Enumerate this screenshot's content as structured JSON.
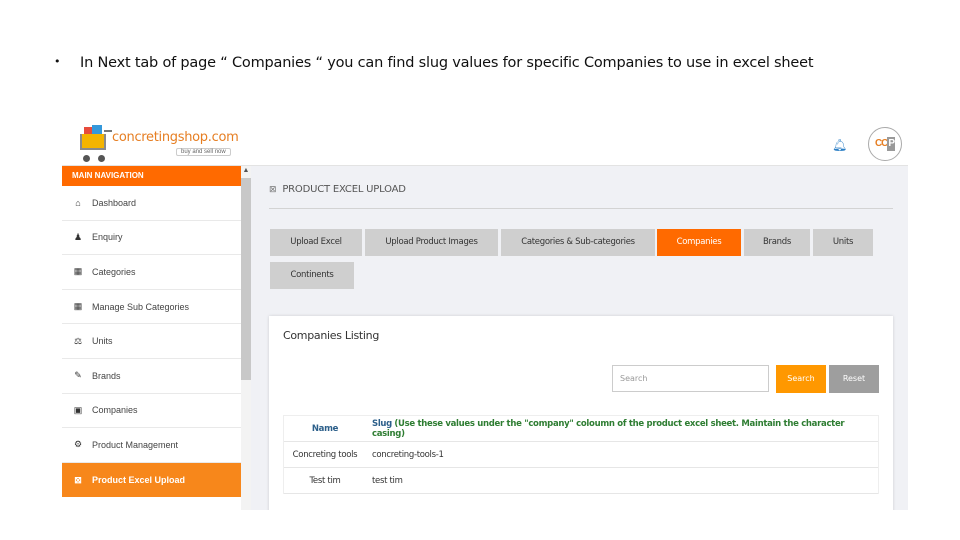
{
  "caption": {
    "bullet": "•",
    "text": "In Next tab of page “ Companies “ you can find slug values for specific Companies to use in excel sheet"
  },
  "header": {
    "brand": "concretingshop.com",
    "tagline": "buy and sell now",
    "bell_icon": "bell-icon",
    "avatar_text": "CC",
    "avatar_p": "P"
  },
  "sidebar": {
    "heading": "MAIN NAVIGATION",
    "items": [
      {
        "label": "Dashboard",
        "icon": "home-icon",
        "glyph": "⌂",
        "active": false
      },
      {
        "label": "Enquiry",
        "icon": "user-icon",
        "glyph": "♟",
        "active": false
      },
      {
        "label": "Categories",
        "icon": "grid-icon",
        "glyph": "▦",
        "active": false
      },
      {
        "label": "Manage Sub Categories",
        "icon": "grid-icon",
        "glyph": "▦",
        "active": false
      },
      {
        "label": "Units",
        "icon": "balance-scale-icon",
        "glyph": "⚖",
        "active": false
      },
      {
        "label": "Brands",
        "icon": "tags-icon",
        "glyph": "✎",
        "active": false
      },
      {
        "label": "Companies",
        "icon": "building-icon",
        "glyph": "▣",
        "active": false
      },
      {
        "label": "Product Management",
        "icon": "cogs-icon",
        "glyph": "⚙",
        "active": false
      },
      {
        "label": "Product Excel Upload",
        "icon": "file-excel-icon",
        "glyph": "⊠",
        "active": true
      }
    ]
  },
  "main": {
    "page_title": "PRODUCT EXCEL UPLOAD",
    "page_title_icon": "file-excel-icon",
    "tabs": [
      {
        "label": "Upload Excel",
        "active": false
      },
      {
        "label": "Upload Product Images",
        "active": false
      },
      {
        "label": "Categories & Sub-categories",
        "active": false
      },
      {
        "label": "Companies",
        "active": true
      },
      {
        "label": "Brands",
        "active": false
      },
      {
        "label": "Units",
        "active": false
      },
      {
        "label": "Continents",
        "active": false
      }
    ],
    "listing": {
      "title": "Companies Listing",
      "search_placeholder": "Search",
      "search_value": "",
      "search_button": "Search",
      "reset_button": "Reset",
      "columns": {
        "name": "Name",
        "slug": "Slug",
        "slug_note": "(Use these values under the \"company\" coloumn of the product excel sheet. Maintain the character casing)"
      },
      "rows": [
        {
          "name": "Concreting tools",
          "slug": "concreting-tools-1"
        },
        {
          "name": "Test tim",
          "slug": "test tim"
        }
      ]
    }
  },
  "colors": {
    "accent_orange": "#ff6a00",
    "active_nav": "#f7871b",
    "search_button": "#ff9800",
    "reset_button": "#9e9e9e",
    "slug_header": "#2c5f8a",
    "slug_note": "#2e7d32"
  }
}
